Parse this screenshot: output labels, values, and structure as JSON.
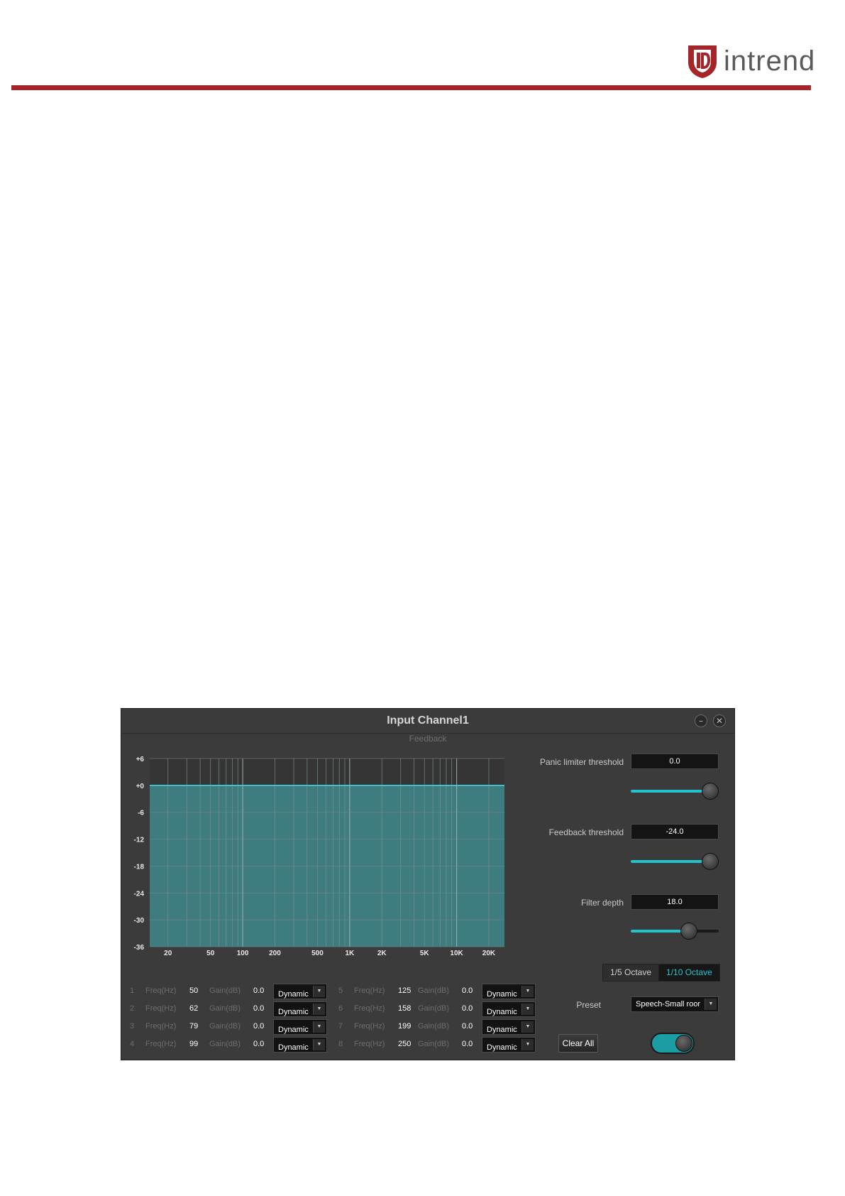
{
  "brand": {
    "name": "intrend",
    "accent": "#a3262a"
  },
  "window": {
    "title": "Input Channel1",
    "section": "Feedback",
    "minimize_icon": "minimize-icon",
    "close_icon": "close-icon"
  },
  "graph": {
    "y_ticks": [
      "+6",
      "+0",
      "-6",
      "-12",
      "-18",
      "-24",
      "-30",
      "-36"
    ],
    "x_ticks": [
      "20",
      "50",
      "100",
      "200",
      "500",
      "1K",
      "2K",
      "5K",
      "10K",
      "20K"
    ],
    "curve_color": "#3fd0e0",
    "fill_color": "#3f7c7f"
  },
  "panel": {
    "panic_limiter_label": "Panic limiter threshold",
    "panic_limiter_value": "0.0",
    "panic_slider_level": 1.0,
    "feedback_threshold_label": "Feedback threshold",
    "feedback_threshold_value": "-24.0",
    "feedback_slider_level": 1.0,
    "filter_depth_label": "Filter depth",
    "filter_depth_value": "18.0",
    "filter_slider_level": 0.7,
    "octave_options": [
      "1/5 Octave",
      "1/10 Octave"
    ],
    "octave_selected": "1/10 Octave",
    "preset_label": "Preset",
    "preset_value": "Speech-Small roor",
    "clear_label": "Clear All",
    "enabled": true,
    "accent": "#22c3cc"
  },
  "bands": [
    {
      "index": "1",
      "freq_label": "Freq(Hz)",
      "freq": "50",
      "gain_label": "Gain(dB)",
      "gain": "0.0",
      "mode": "Dynamic"
    },
    {
      "index": "2",
      "freq_label": "Freq(Hz)",
      "freq": "62",
      "gain_label": "Gain(dB)",
      "gain": "0.0",
      "mode": "Dynamic"
    },
    {
      "index": "3",
      "freq_label": "Freq(Hz)",
      "freq": "79",
      "gain_label": "Gain(dB)",
      "gain": "0.0",
      "mode": "Dynamic"
    },
    {
      "index": "4",
      "freq_label": "Freq(Hz)",
      "freq": "99",
      "gain_label": "Gain(dB)",
      "gain": "0.0",
      "mode": "Dynamic"
    },
    {
      "index": "5",
      "freq_label": "Freq(Hz)",
      "freq": "125",
      "gain_label": "Gain(dB)",
      "gain": "0.0",
      "mode": "Dynamic"
    },
    {
      "index": "6",
      "freq_label": "Freq(Hz)",
      "freq": "158",
      "gain_label": "Gain(dB)",
      "gain": "0.0",
      "mode": "Dynamic"
    },
    {
      "index": "7",
      "freq_label": "Freq(Hz)",
      "freq": "199",
      "gain_label": "Gain(dB)",
      "gain": "0.0",
      "mode": "Dynamic"
    },
    {
      "index": "8",
      "freq_label": "Freq(Hz)",
      "freq": "250",
      "gain_label": "Gain(dB)",
      "gain": "0.0",
      "mode": "Dynamic"
    }
  ]
}
